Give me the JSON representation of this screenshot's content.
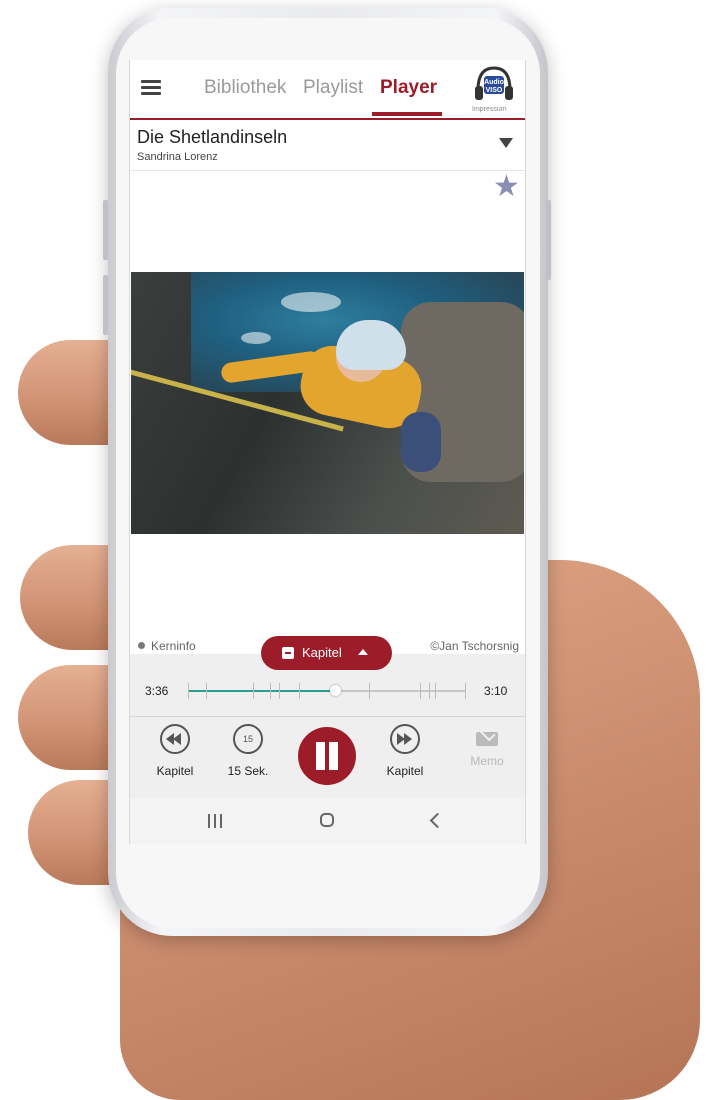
{
  "header": {
    "tabs": [
      {
        "label": "Bibliothek"
      },
      {
        "label": "Playlist"
      },
      {
        "label": "Player"
      }
    ],
    "logo_text": "Audio VISO",
    "impressum": "Impressum"
  },
  "track": {
    "title": "Die Shetlandinseln",
    "author": "Sandrina Lorenz"
  },
  "caption": {
    "left": "Kerninfo",
    "right": "©Jan Tschorsnig"
  },
  "chapter_button": {
    "label": "Kapitel"
  },
  "progress": {
    "elapsed": "3:36",
    "remaining": "3:10",
    "position_fraction": 0.53
  },
  "controls": {
    "prev_chapter": "Kapitel",
    "skip_back": "15 Sek.",
    "skip_back_icon_value": "15",
    "next_chapter": "Kapitel",
    "memo": "Memo"
  },
  "colors": {
    "accent": "#9d1c2a",
    "progress": "#2a9d8f",
    "favorite": "#8c8fb3"
  }
}
